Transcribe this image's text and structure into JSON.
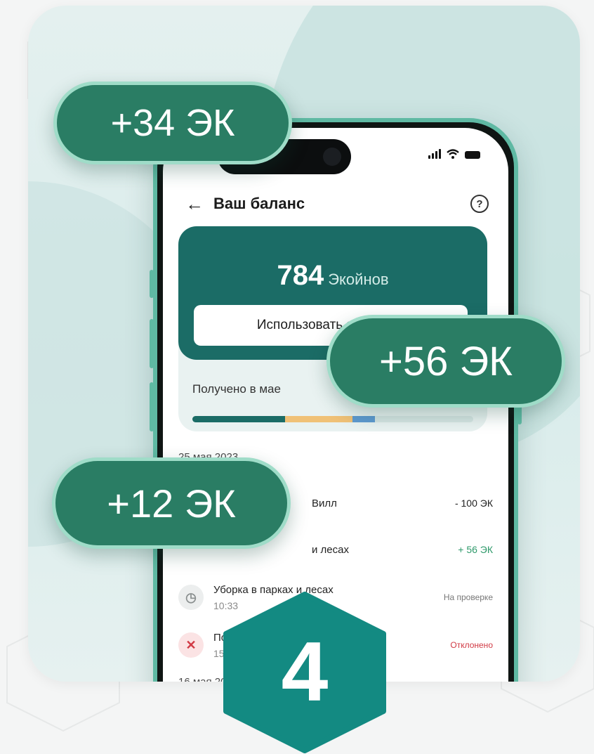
{
  "header": {
    "title": "Ваш баланс",
    "back_icon": "arrow-left-icon",
    "help_icon": "question-icon"
  },
  "balance": {
    "amount": "784",
    "unit": "Экойнов",
    "use_button_label": "Использовать экокойны",
    "received_label": "Получено в мае"
  },
  "transactions": {
    "date_1": "25 мая 2023",
    "date_2": "16 мая 2023",
    "items": [
      {
        "name": "Вилл",
        "time": "",
        "amount": "- 100 ЭК"
      },
      {
        "name": "и лесах",
        "time": "",
        "amount": "+ 56 ЭК"
      },
      {
        "name": "Уборка в парках и лесах",
        "time": "10:33",
        "amount": "На проверке"
      },
      {
        "name": "Покупка",
        "time": "15:45",
        "amount": "Отклонено"
      }
    ]
  },
  "badges": {
    "badge_1": "+34 ЭК",
    "badge_2": "+56 ЭК",
    "badge_3": "+12 ЭК"
  },
  "step": {
    "number": "4"
  },
  "colors": {
    "brand_dark": "#1b6c66",
    "pill_green": "#2a7d64",
    "pill_border": "#9fdcc8",
    "hex_teal": "#138a82",
    "negative": "#d13a45",
    "positive": "#2f9a6b"
  }
}
